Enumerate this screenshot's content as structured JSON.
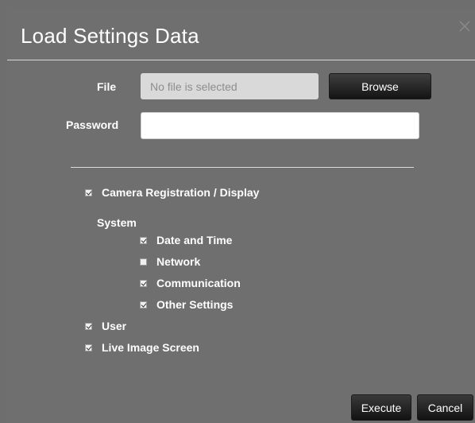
{
  "dialog": {
    "title": "Load Settings Data",
    "close_icon": "close-icon"
  },
  "form": {
    "file_label": "File",
    "file_placeholder": "No file is selected",
    "browse_label": "Browse",
    "password_label": "Password",
    "password_value": ""
  },
  "options": {
    "camera_registration": {
      "label": "Camera Registration / Display",
      "checked": true
    },
    "system_label": "System",
    "date_time": {
      "label": "Date and Time",
      "checked": true
    },
    "network": {
      "label": "Network",
      "checked": false
    },
    "communication": {
      "label": "Communication",
      "checked": true
    },
    "other_settings": {
      "label": "Other Settings",
      "checked": true
    },
    "user": {
      "label": "User",
      "checked": true
    },
    "live_image_screen": {
      "label": "Live Image Screen",
      "checked": true
    }
  },
  "footer": {
    "execute_label": "Execute",
    "cancel_label": "Cancel"
  },
  "colors": {
    "background": "#6f6f6f",
    "button_dark": "#1a1a1a",
    "text": "#ffffff"
  }
}
